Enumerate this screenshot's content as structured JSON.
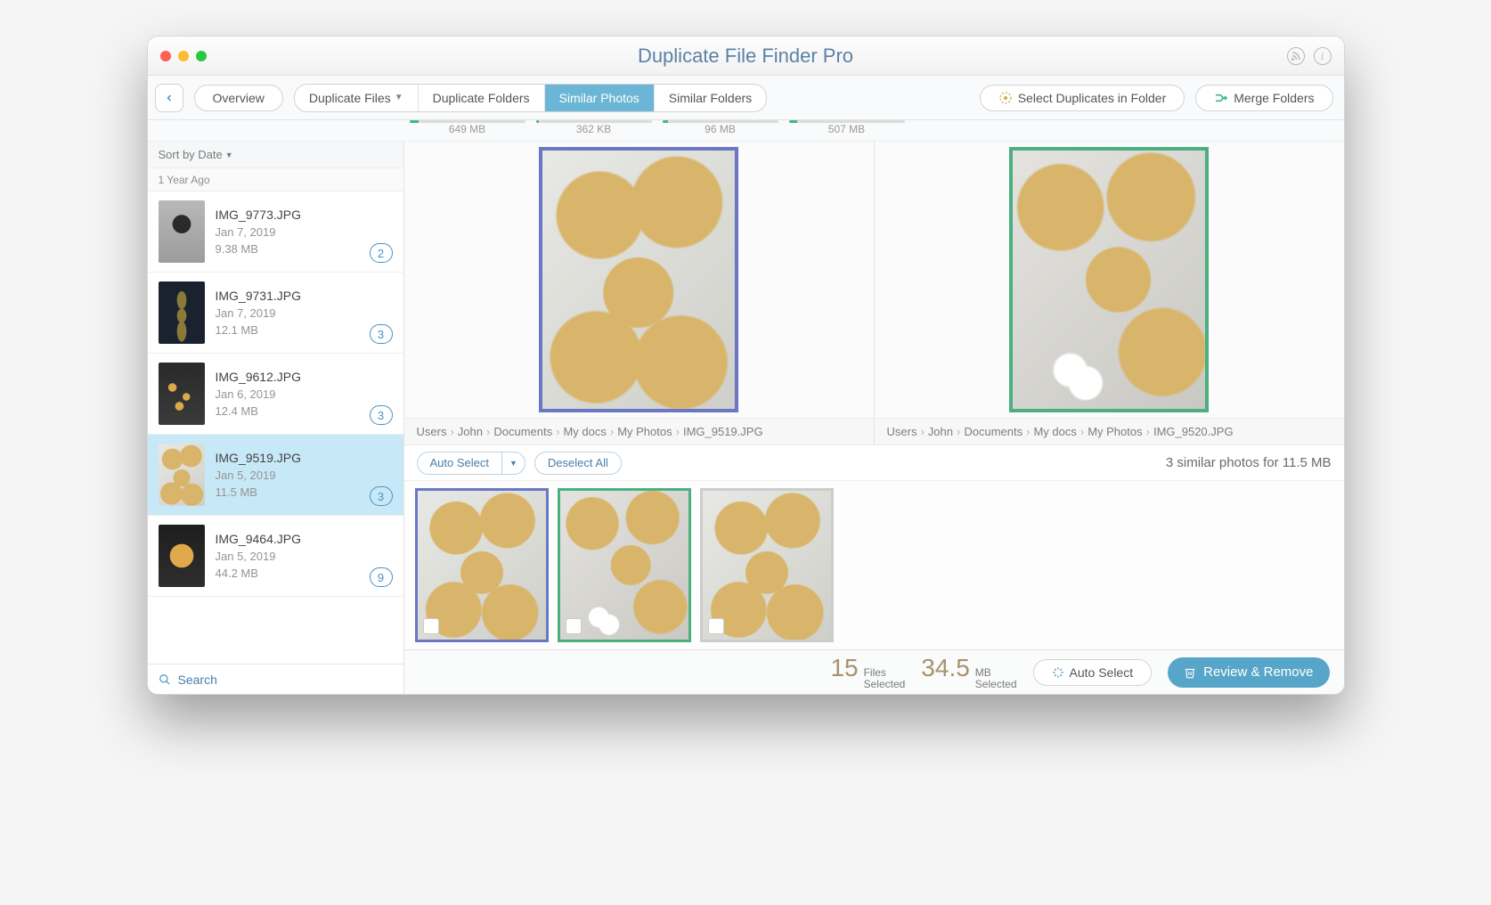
{
  "app_title": "Duplicate File Finder Pro",
  "toolbar": {
    "overview": "Overview",
    "tabs": [
      {
        "label": "Duplicate Files",
        "size": "649 MB",
        "fill": 8
      },
      {
        "label": "Duplicate Folders",
        "size": "362 KB",
        "fill": 3
      },
      {
        "label": "Similar Photos",
        "size": "96 MB",
        "fill": 5,
        "active": true
      },
      {
        "label": "Similar Folders",
        "size": "507 MB",
        "fill": 7
      }
    ],
    "select_in_folder": "Select Duplicates in Folder",
    "merge_folders": "Merge Folders"
  },
  "sidebar": {
    "sort_label": "Sort by Date",
    "group_label": "1 Year Ago",
    "items": [
      {
        "name": "IMG_9773.JPG",
        "date": "Jan 7, 2019",
        "size": "9.38 MB",
        "count": "2",
        "thumb": "ph-portrait"
      },
      {
        "name": "IMG_9731.JPG",
        "date": "Jan 7, 2019",
        "size": "12.1 MB",
        "count": "3",
        "thumb": "ph-avocado"
      },
      {
        "name": "IMG_9612.JPG",
        "date": "Jan 6, 2019",
        "size": "12.4 MB",
        "count": "3",
        "thumb": "ph-flowers"
      },
      {
        "name": "IMG_9519.JPG",
        "date": "Jan 5, 2019",
        "size": "11.5 MB",
        "count": "3",
        "thumb": "ph-cookies",
        "selected": true
      },
      {
        "name": "IMG_9464.JPG",
        "date": "Jan 5, 2019",
        "size": "44.2 MB",
        "count": "9",
        "thumb": "ph-flower2"
      }
    ],
    "search_label": "Search"
  },
  "compare": {
    "left_path": [
      "Users",
      "John",
      "Documents",
      "My docs",
      "My Photos",
      "IMG_9519.JPG"
    ],
    "right_path": [
      "Users",
      "John",
      "Documents",
      "My docs",
      "My Photos",
      "IMG_9520.JPG"
    ]
  },
  "actionbar": {
    "auto_select": "Auto Select",
    "deselect_all": "Deselect All",
    "summary": "3 similar photos for 11.5 MB"
  },
  "footer": {
    "files_count": "15",
    "files_label_top": "Files",
    "files_label_bot": "Selected",
    "mb_count": "34.5",
    "mb_label_top": "MB",
    "mb_label_bot": "Selected",
    "auto_select": "Auto Select",
    "review": "Review & Remove"
  }
}
